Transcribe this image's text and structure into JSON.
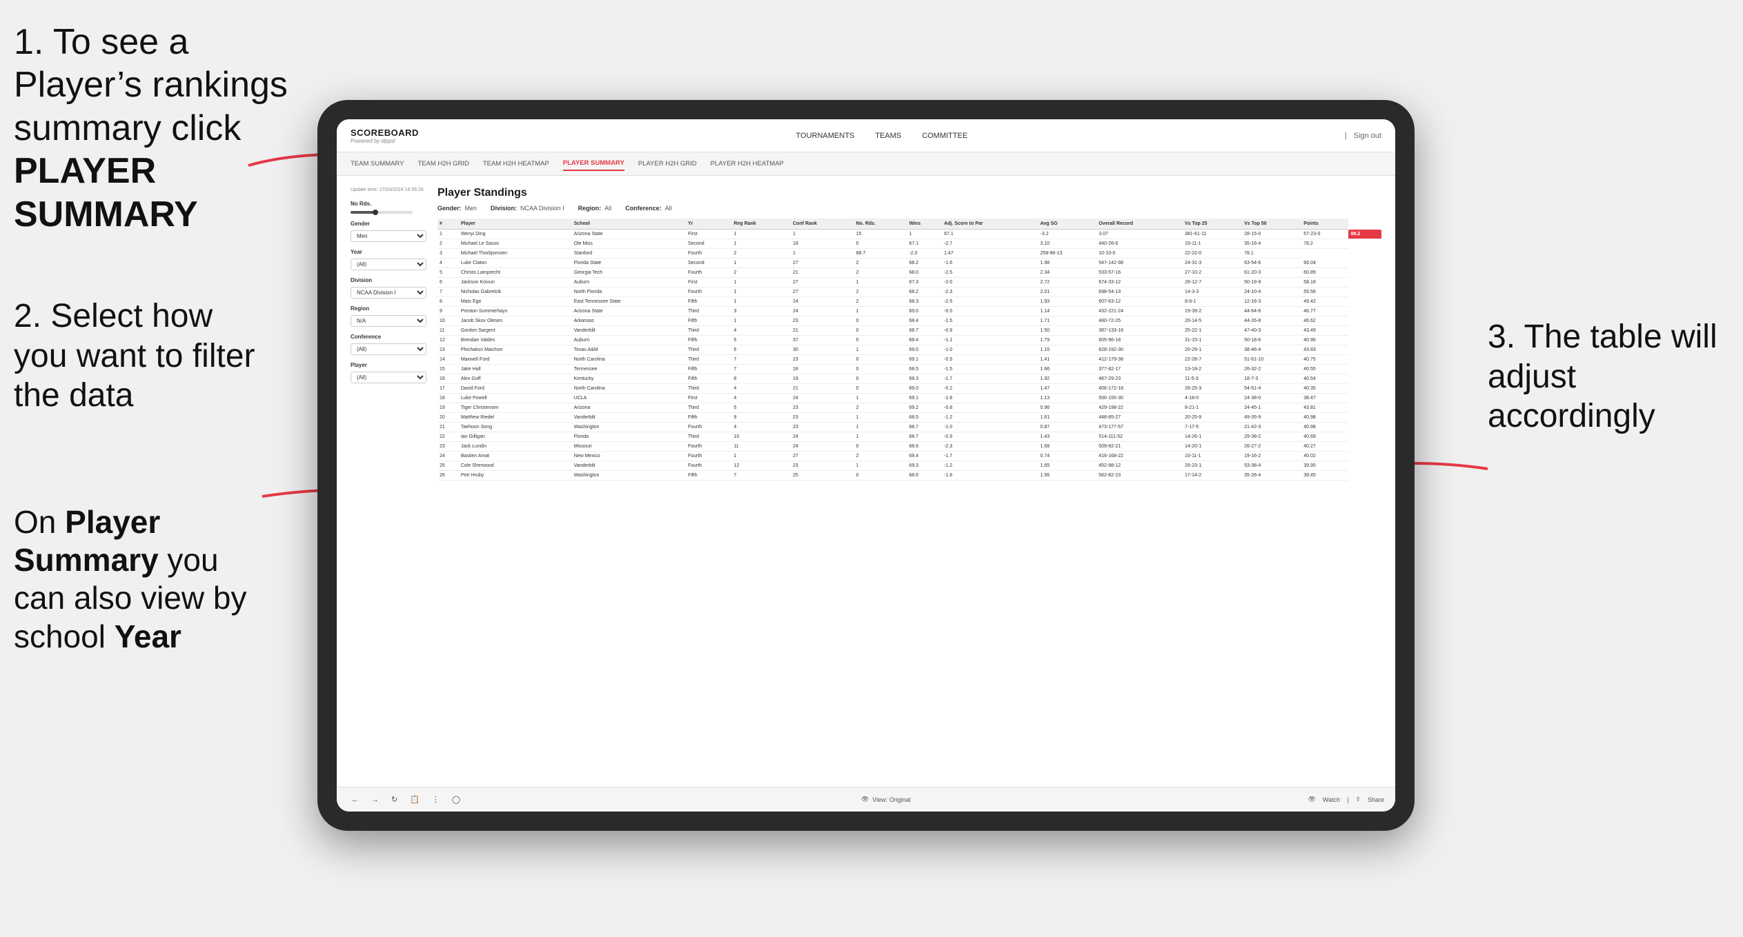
{
  "instructions": {
    "step1": {
      "text_before": "1. To see a Player’s rankings summary click ",
      "bold": "PLAYER SUMMARY"
    },
    "step2": {
      "text": "2. Select how you want to filter the data"
    },
    "step_on": {
      "text_before": "On ",
      "bold1": "Player Summary",
      "text_middle": " you can also view by school ",
      "bold2": "Year"
    },
    "step3": {
      "text": "3. The table will adjust accordingly"
    }
  },
  "app": {
    "logo": "SCOREBOARD",
    "logo_sub": "Powered by dippd",
    "nav": [
      "TOURNAMENTS",
      "TEAMS",
      "COMMITTEE"
    ],
    "header_right": [
      "Sign out"
    ],
    "sub_nav": [
      "TEAM SUMMARY",
      "TEAM H2H GRID",
      "TEAM H2H HEATMAP",
      "PLAYER SUMMARY",
      "PLAYER H2H GRID",
      "PLAYER H2H HEATMAP"
    ],
    "active_sub_nav": "PLAYER SUMMARY"
  },
  "update_time": "Update time:\n27/03/2024 16:56:26",
  "standings": {
    "title": "Player Standings",
    "filters": {
      "gender": {
        "label": "Gender",
        "value": "Men"
      },
      "division": {
        "label": "Division",
        "value": "NCAA Division I"
      },
      "region": {
        "label": "Region",
        "value": "All"
      },
      "conference": {
        "label": "Conference",
        "value": "All"
      }
    },
    "left_filters": {
      "no_rds": "No Rds.",
      "gender_label": "Gender",
      "gender_value": "Men",
      "year_label": "Year",
      "year_value": "(All)",
      "division_label": "Division",
      "division_value": "NCAA Division I",
      "region_label": "Region",
      "region_value": "N/A",
      "conference_label": "Conference",
      "conference_value": "(All)",
      "player_label": "Player",
      "player_value": "(All)"
    },
    "columns": [
      "#",
      "Player",
      "School",
      "Yr",
      "Reg Rank",
      "Conf Rank",
      "No. Rds.",
      "Wins",
      "Adj. Score to Par",
      "Avg SG",
      "Overall Record",
      "Vs Top 25",
      "Vs Top 50",
      "Points"
    ],
    "rows": [
      [
        "1",
        "Wenyi Ding",
        "Arizona State",
        "First",
        "1",
        "1",
        "15",
        "1",
        "67.1",
        "-3.2",
        "3.07",
        "381-61-11",
        "28-15-0",
        "57-23-0",
        "88.2"
      ],
      [
        "2",
        "Michael Le Sasso",
        "Ole Miss",
        "Second",
        "1",
        "18",
        "0",
        "67.1",
        "-2.7",
        "3.10",
        "440-26-6",
        "19-11-1",
        "35-16-4",
        "78.2"
      ],
      [
        "3",
        "Michael Thorbjornsen",
        "Stanford",
        "Fourth",
        "2",
        "1",
        "88.7",
        "-2.0",
        "1.47",
        "258-96-13",
        "10-10-0",
        "22-22-0",
        "78.1"
      ],
      [
        "4",
        "Luke Claton",
        "Florida State",
        "Second",
        "1",
        "27",
        "2",
        "68.2",
        "-1.6",
        "1.98",
        "547-142-98",
        "24-31-3",
        "63-54-6",
        "66.04"
      ],
      [
        "5",
        "Christo Lamprecht",
        "Georgia Tech",
        "Fourth",
        "2",
        "21",
        "2",
        "68.0",
        "-2.5",
        "2.34",
        "533-57-16",
        "27-10-2",
        "61-20-3",
        "60.89"
      ],
      [
        "6",
        "Jackson Koivun",
        "Auburn",
        "First",
        "1",
        "27",
        "1",
        "67.3",
        "-2.0",
        "2.72",
        "674-33-12",
        "28-12-7",
        "50-19-9",
        "58.18"
      ],
      [
        "7",
        "Nicholas Gabrelcik",
        "North Florida",
        "Fourth",
        "1",
        "27",
        "2",
        "68.2",
        "-2.3",
        "2.01",
        "698-54-13",
        "14-3-3",
        "24-10-4",
        "55.56"
      ],
      [
        "8",
        "Mats Ege",
        "East Tennessee State",
        "Fifth",
        "1",
        "24",
        "2",
        "68.3",
        "-2.5",
        "1.93",
        "607-63-12",
        "8-6-1",
        "12-16-3",
        "49.42"
      ],
      [
        "9",
        "Preston Summerhays",
        "Arizona State",
        "Third",
        "3",
        "24",
        "1",
        "69.0",
        "-0.5",
        "1.14",
        "432-221-24",
        "19-39-2",
        "44-64-6",
        "46.77"
      ],
      [
        "10",
        "Jacob Skov Olesen",
        "Arkansas",
        "Fifth",
        "1",
        "23",
        "0",
        "68.4",
        "-1.5",
        "1.71",
        "480-72-25",
        "20-14-5",
        "44-26-8",
        "46.62"
      ],
      [
        "11",
        "Gordon Sargent",
        "Vanderbilt",
        "Third",
        "4",
        "21",
        "0",
        "68.7",
        "-0.9",
        "1.50",
        "387-133-16",
        "25-22-1",
        "47-40-3",
        "43.49"
      ],
      [
        "12",
        "Brendan Valdes",
        "Auburn",
        "Fifth",
        "5",
        "37",
        "0",
        "68.4",
        "-1.1",
        "1.79",
        "605-96-18",
        "31-15-1",
        "50-18-6",
        "40.96"
      ],
      [
        "13",
        "Phichaksn Maichon",
        "Texas A&M",
        "Third",
        "6",
        "30",
        "1",
        "69.0",
        "-1.0",
        "1.15",
        "628-192-30",
        "20-29-1",
        "38-46-4",
        "43.83"
      ],
      [
        "14",
        "Maxwell Ford",
        "North Carolina",
        "Third",
        "7",
        "23",
        "0",
        "69.1",
        "-0.5",
        "1.41",
        "412-179-38",
        "22-28-7",
        "51-61-10",
        "40.75"
      ],
      [
        "15",
        "Jake Hall",
        "Tennessee",
        "Fifth",
        "7",
        "18",
        "0",
        "68.5",
        "-1.5",
        "1.66",
        "377-82-17",
        "13-18-2",
        "26-32-2",
        "40.55"
      ],
      [
        "16",
        "Alex Goff",
        "Kentucky",
        "Fifth",
        "8",
        "19",
        "0",
        "68.3",
        "-1.7",
        "1.92",
        "467-29-23",
        "11-5-3",
        "18-7-3",
        "40.54"
      ],
      [
        "17",
        "David Ford",
        "North Carolina",
        "Third",
        "4",
        "21",
        "0",
        "69.0",
        "-0.2",
        "1.47",
        "406-172-18",
        "26-25-3",
        "54-51-4",
        "40.35"
      ],
      [
        "18",
        "Luke Powell",
        "UCLA",
        "First",
        "4",
        "24",
        "1",
        "69.1",
        "-1.8",
        "1.13",
        "500-155-30",
        "4-18-0",
        "24-38-0",
        "38.47"
      ],
      [
        "19",
        "Tiger Christensen",
        "Arizona",
        "Third",
        "5",
        "23",
        "2",
        "69.2",
        "-0.8",
        "0.96",
        "429-198-22",
        "8-21-1",
        "24-45-1",
        "43.81"
      ],
      [
        "20",
        "Matthew Riedel",
        "Vanderbilt",
        "Fifth",
        "9",
        "23",
        "1",
        "68.5",
        "-1.2",
        "1.61",
        "448-85-27",
        "20-25-9",
        "49-35-9",
        "40.98"
      ],
      [
        "21",
        "Taehoon Song",
        "Washington",
        "Fourth",
        "4",
        "23",
        "1",
        "68.7",
        "-1.0",
        "0.87",
        "473-177-57",
        "7-17-5",
        "21-42-3",
        "40.98"
      ],
      [
        "22",
        "Ian Gilligan",
        "Florida",
        "Third",
        "10",
        "24",
        "1",
        "68.7",
        "-0.9",
        "1.43",
        "514-111-52",
        "14-26-1",
        "29-38-2",
        "40.69"
      ],
      [
        "23",
        "Jack Lundin",
        "Missouri",
        "Fourth",
        "11",
        "24",
        "0",
        "68.6",
        "-2.3",
        "1.68",
        "509-82-21",
        "14-20-1",
        "26-27-2",
        "40.27"
      ],
      [
        "24",
        "Bastien Amat",
        "New Mexico",
        "Fourth",
        "1",
        "27",
        "2",
        "69.4",
        "-1.7",
        "0.74",
        "416-168-22",
        "10-11-1",
        "19-16-2",
        "40.02"
      ],
      [
        "25",
        "Cole Sherwood",
        "Vanderbilt",
        "Fourth",
        "12",
        "23",
        "1",
        "69.3",
        "-1.2",
        "1.65",
        "452-98-12",
        "26-23-1",
        "53-38-4",
        "39.95"
      ],
      [
        "26",
        "Petr Hruby",
        "Washington",
        "Fifth",
        "7",
        "25",
        "0",
        "68.6",
        "-1.8",
        "1.56",
        "562-82-23",
        "17-14-2",
        "35-26-4",
        "39.45"
      ]
    ]
  },
  "toolbar": {
    "view": "View: Original",
    "watch": "Watch",
    "share": "Share"
  }
}
